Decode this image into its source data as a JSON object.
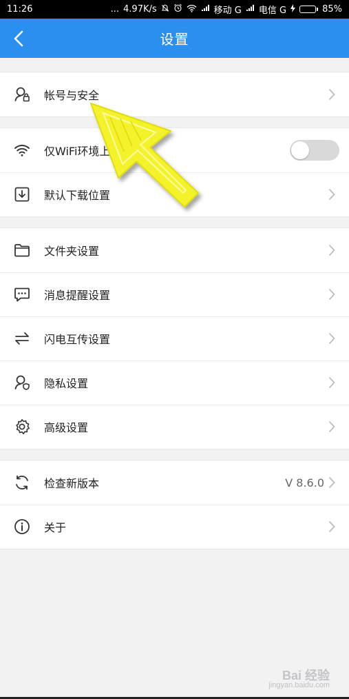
{
  "status_bar": {
    "time": "11:26",
    "dots": "...",
    "speed": "4.97K/s",
    "carrier1": "移动 G",
    "carrier2": "电信 G",
    "battery_text": "85%",
    "battery_level": 0.85,
    "battery_color": "#45e04a"
  },
  "header": {
    "title": "设置",
    "back_icon": "chevron-left-icon",
    "color": "#2b8fef"
  },
  "groups": {
    "account": {
      "label": "帐号与安全",
      "icon": "user-lock-icon"
    },
    "transfer": {
      "wifi_label": "仅WiFi环境上传/下载",
      "wifi_icon": "wifi-icon",
      "wifi_toggle": false,
      "download_label": "默认下载位置",
      "download_icon": "download-box-icon"
    },
    "settings": {
      "folder_label": "文件夹设置",
      "folder_icon": "folder-icon",
      "message_label": "消息提醒设置",
      "message_icon": "chat-bubble-icon",
      "flash_label": "闪电互传设置",
      "flash_icon": "swap-arrows-icon",
      "privacy_label": "隐私设置",
      "privacy_icon": "user-shield-icon",
      "advanced_label": "高级设置",
      "advanced_icon": "gear-icon"
    },
    "about": {
      "update_label": "检查新版本",
      "update_icon": "refresh-icon",
      "version": "V 8.6.0",
      "about_label": "关于",
      "about_icon": "info-circle-icon"
    }
  },
  "watermark": {
    "text": "Bai 经验",
    "sub": "jingyan.baidu.com"
  }
}
